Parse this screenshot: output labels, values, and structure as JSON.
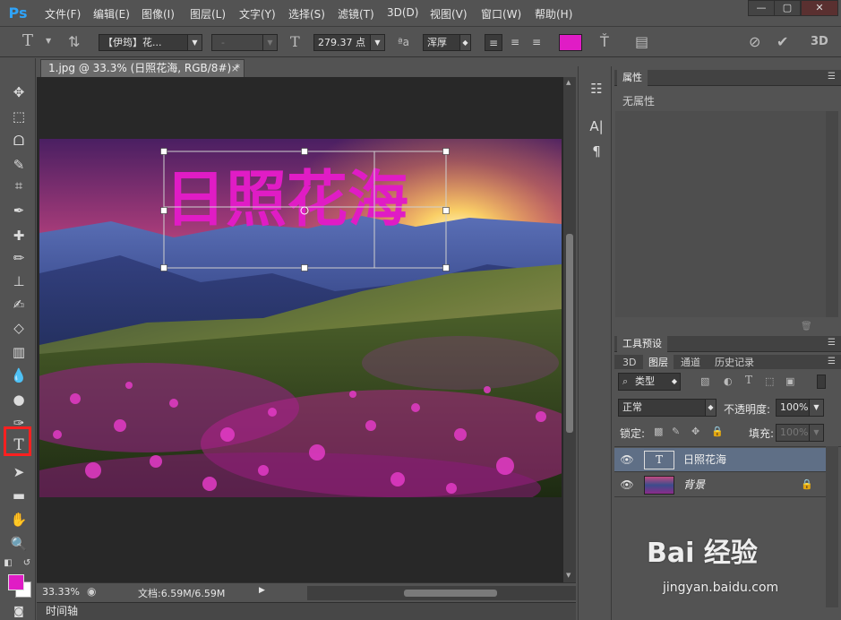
{
  "app": {
    "logo": "Ps",
    "menu": [
      "文件(F)",
      "编辑(E)",
      "图像(I)",
      "图层(L)",
      "文字(Y)",
      "选择(S)",
      "滤镜(T)",
      "3D(D)",
      "视图(V)",
      "窗口(W)",
      "帮助(H)"
    ],
    "window_controls": [
      "—",
      "▢",
      "✕"
    ]
  },
  "options": {
    "font_family": "【伊筠】花...",
    "font_style": "-",
    "font_size": "279.37 点",
    "antialias": "浑厚",
    "text_color": "#e01cc5",
    "dim_label": "3D"
  },
  "document": {
    "tab_title": "1.jpg @ 33.3% (日照花海, RGB/8#) *",
    "close": "×",
    "canvas_text": "日照花海",
    "text_color": "#e01cc5"
  },
  "status": {
    "zoom": "33.33%",
    "doc_info": "文档:6.59M/6.59M"
  },
  "timeline": {
    "label": "时间轴"
  },
  "panels": {
    "properties": {
      "tab": "属性",
      "empty_text": "无属性"
    },
    "tool_presets": {
      "tab": "工具预设"
    },
    "layers_tabs": [
      "3D",
      "图层",
      "通道",
      "历史记录"
    ],
    "active_tab": "图层",
    "filter_label": "类型",
    "blend_mode": "正常",
    "opacity_label": "不透明度:",
    "opacity_value": "100%",
    "lock_label": "锁定:",
    "fill_label": "填充:",
    "fill_value": "100%",
    "layers": [
      {
        "name": "日照花海",
        "type": "text",
        "selected": true
      },
      {
        "name": "背景",
        "type": "image",
        "selected": false,
        "locked": true
      }
    ]
  },
  "colors": {
    "foreground": "#e01cc5",
    "background": "#ffffff"
  },
  "watermark": {
    "brand": "Bai 经验",
    "url": "jingyan.baidu.com"
  }
}
